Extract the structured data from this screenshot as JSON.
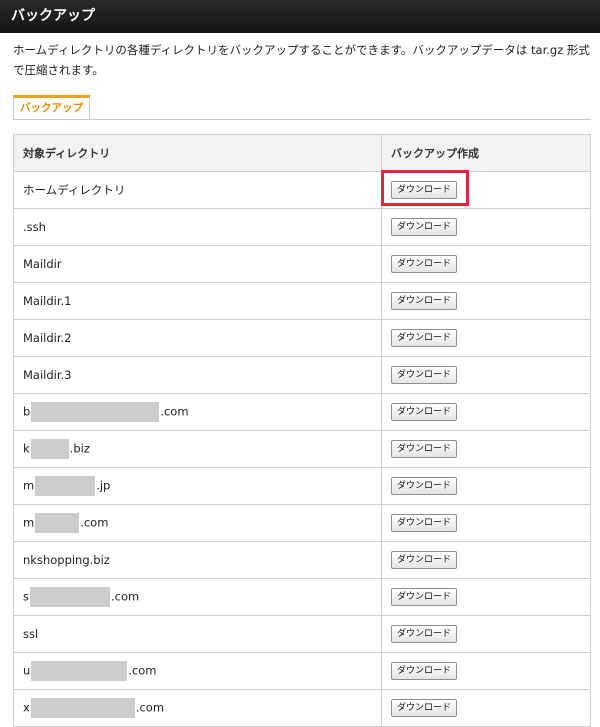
{
  "header": {
    "title": "バックアップ"
  },
  "description": "ホームディレクトリの各種ディレクトリをバックアップすることができます。バックアップデータは tar.gz 形式で圧縮されます。",
  "tabs": [
    {
      "label": "バックアップ",
      "active": true
    }
  ],
  "table": {
    "columns": [
      "対象ディレクトリ",
      "バックアップ作成"
    ],
    "button_label": "ダウンロード",
    "rows": [
      {
        "pre": "ホームディレクトリ",
        "post": "",
        "mask": 0
      },
      {
        "pre": ".ssh",
        "post": "",
        "mask": 0
      },
      {
        "pre": "Maildir",
        "post": "",
        "mask": 0
      },
      {
        "pre": "Maildir.1",
        "post": "",
        "mask": 0
      },
      {
        "pre": "Maildir.2",
        "post": "",
        "mask": 0
      },
      {
        "pre": "Maildir.3",
        "post": "",
        "mask": 0
      },
      {
        "pre": "b",
        "post": ".com",
        "mask": 1
      },
      {
        "pre": "k",
        "post": ".biz",
        "mask": 1
      },
      {
        "pre": "m",
        "post": ".jp",
        "mask": 1
      },
      {
        "pre": "m",
        "post": ".com",
        "mask": 1
      },
      {
        "pre": "nkshopping.biz",
        "post": "",
        "mask": 0
      },
      {
        "pre": "s",
        "post": ".com",
        "mask": 1
      },
      {
        "pre": "ssl",
        "post": "",
        "mask": 0
      },
      {
        "pre": "u",
        "post": ".com",
        "mask": 1
      },
      {
        "pre": "x",
        "post": ".com",
        "mask": 1
      }
    ]
  },
  "colors": {
    "header_bg": "#1e1e1e",
    "tab_accent": "#f0a020",
    "highlight": "#e0283c",
    "redaction": "#cccccc"
  }
}
